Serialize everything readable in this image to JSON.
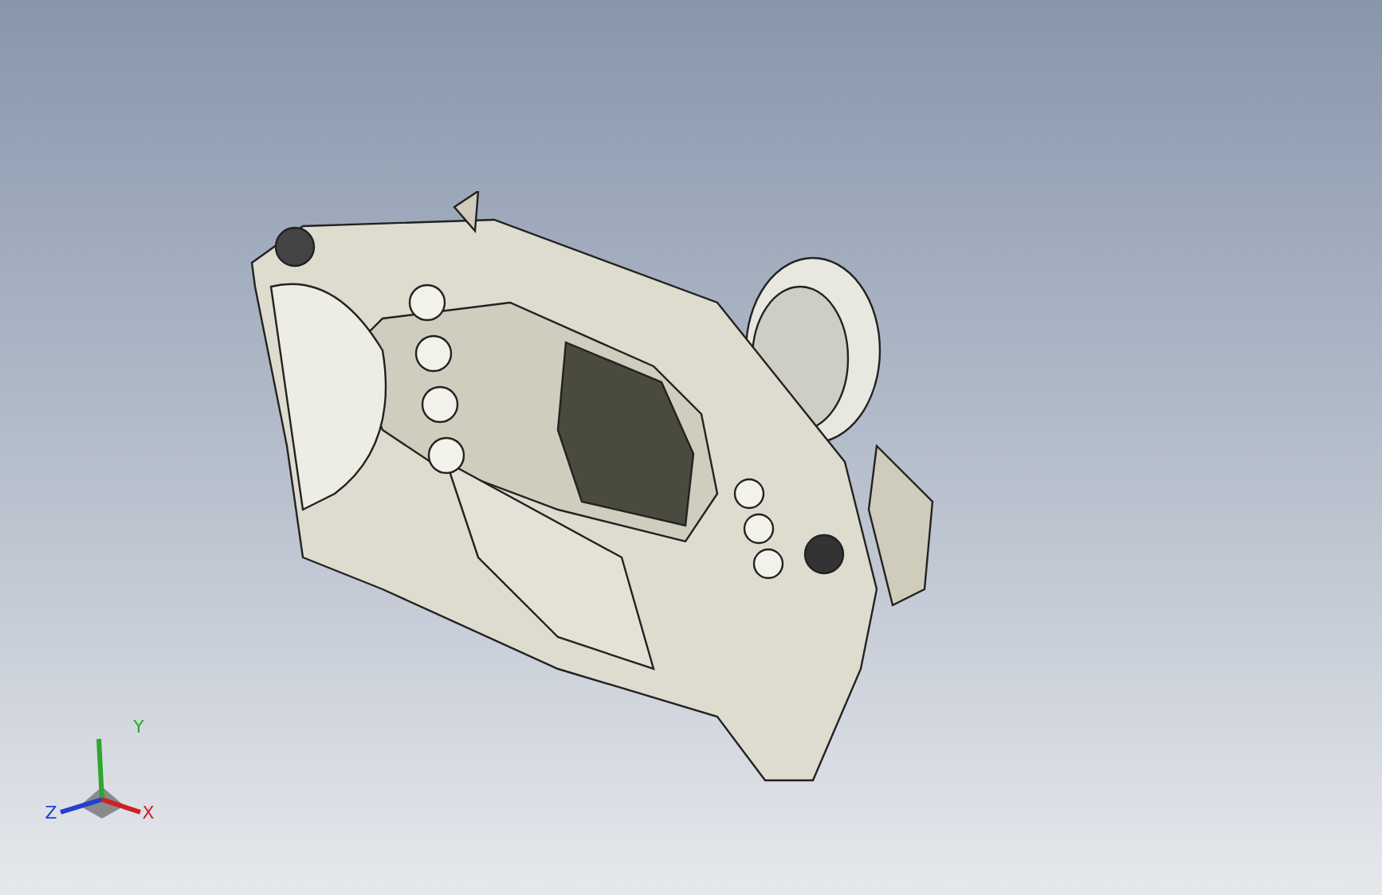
{
  "viewport": {
    "triad": {
      "axes": [
        {
          "label": "Y",
          "color": "#2fa52f"
        },
        {
          "label": "Z",
          "color": "#2340d0"
        },
        {
          "label": "X",
          "color": "#d02020"
        }
      ]
    }
  }
}
